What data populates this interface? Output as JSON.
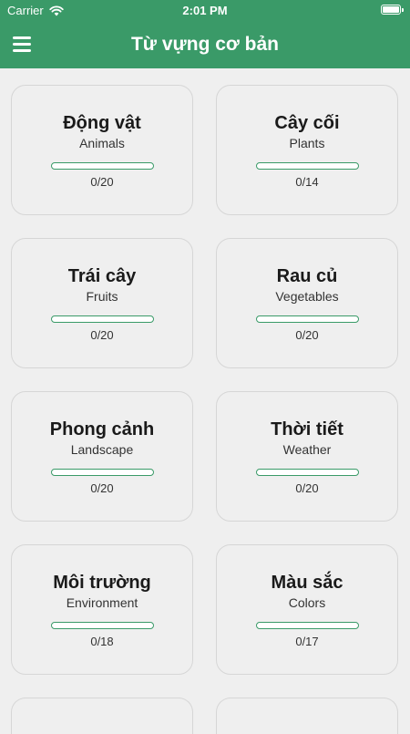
{
  "status": {
    "carrier": "Carrier",
    "time": "2:01 PM"
  },
  "header": {
    "title": "Từ vựng cơ bản"
  },
  "colors": {
    "accent": "#3a9a68",
    "background": "#efefef"
  },
  "topics": [
    {
      "name": "Động vật",
      "english": "Animals",
      "progress": "0/20",
      "fraction": 0
    },
    {
      "name": "Cây cối",
      "english": "Plants",
      "progress": "0/14",
      "fraction": 0
    },
    {
      "name": "Trái cây",
      "english": "Fruits",
      "progress": "0/20",
      "fraction": 0
    },
    {
      "name": "Rau củ",
      "english": "Vegetables",
      "progress": "0/20",
      "fraction": 0
    },
    {
      "name": "Phong cảnh",
      "english": "Landscape",
      "progress": "0/20",
      "fraction": 0
    },
    {
      "name": "Thời tiết",
      "english": "Weather",
      "progress": "0/20",
      "fraction": 0
    },
    {
      "name": "Môi trường",
      "english": "Environment",
      "progress": "0/18",
      "fraction": 0
    },
    {
      "name": "Màu sắc",
      "english": "Colors",
      "progress": "0/17",
      "fraction": 0
    }
  ]
}
